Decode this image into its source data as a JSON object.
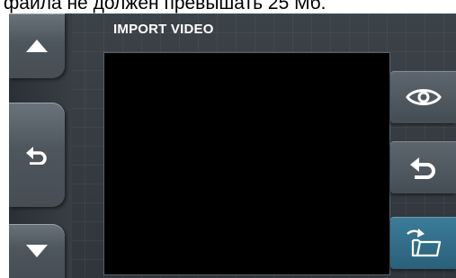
{
  "caption": "файла не должен превышать 25 Мб.",
  "title": "IMPORT VIDEO",
  "nav": {
    "up_icon": "triangle-up-icon",
    "back_icon": "return-arrow-icon",
    "down_icon": "triangle-down-icon"
  },
  "side_buttons": {
    "preview_icon": "eye-icon",
    "return_icon": "return-arrow-icon",
    "import_icon": "folder-import-icon"
  },
  "colors": {
    "panel": "#343a3f",
    "button_grey": "#4e565d",
    "button_teal": "#2f6b86",
    "preview_bg": "#000000",
    "text": "#ffffff"
  }
}
